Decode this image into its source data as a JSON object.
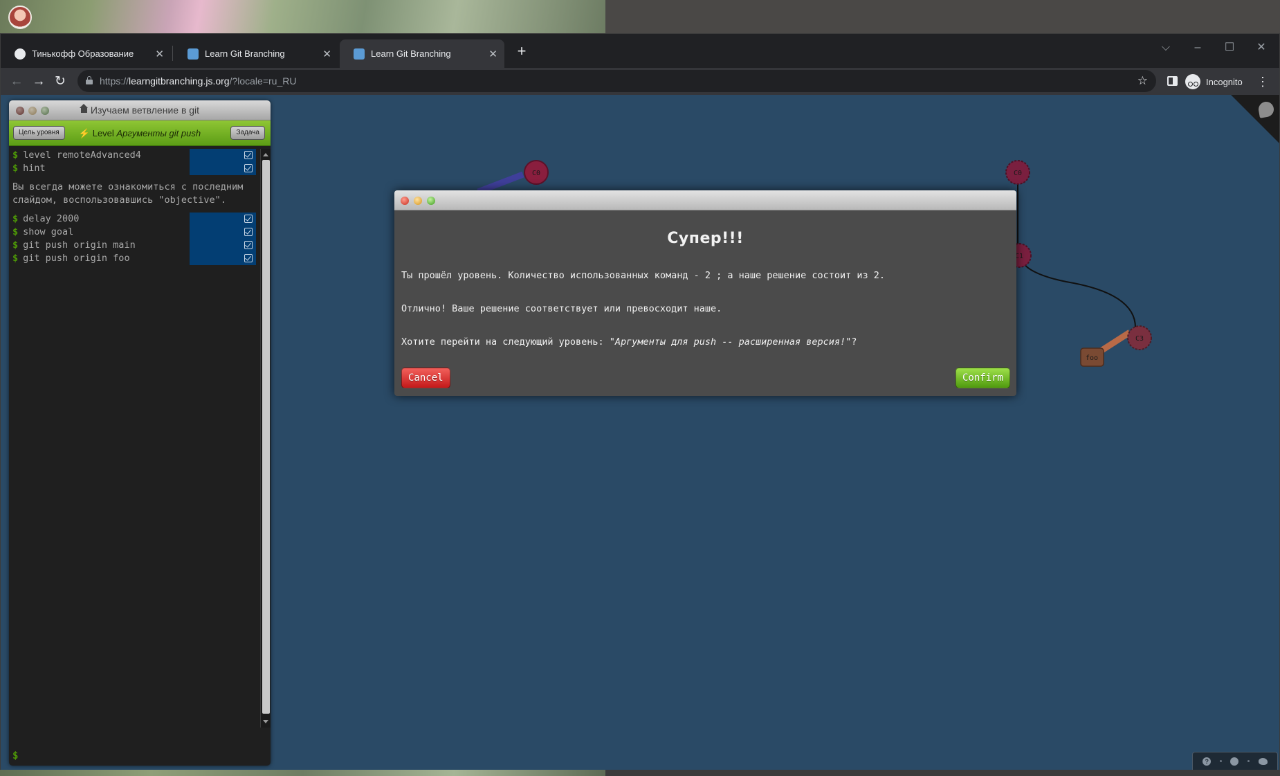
{
  "browser": {
    "tabs": [
      {
        "title": "Тинькофф Образование",
        "favicon_color": "#e8eaed",
        "active": false
      },
      {
        "title": "Learn Git Branching",
        "favicon_color": "#5b9bd5",
        "active": false
      },
      {
        "title": "Learn Git Branching",
        "favicon_color": "#5b9bd5",
        "active": true
      }
    ],
    "new_tab_symbol": "+",
    "window_controls": {
      "dropdown": "⌵",
      "minimize": "–",
      "maximize": "☐",
      "close": "✕"
    },
    "nav": {
      "back": "←",
      "forward": "→",
      "reload": "↻"
    },
    "url_scheme": "https://",
    "url_host": "learngitbranching.js.org",
    "url_path": "/?locale=ru_RU",
    "star_icon": "☆",
    "incognito_label": "Incognito",
    "menu_icon": "⋮"
  },
  "terminal": {
    "title": "Изучаем ветвление в git",
    "goal_button": "Цель уровня",
    "level_prefix": "Level",
    "level_name": "Аргументы git push",
    "objective_button": "Задача",
    "commands": [
      {
        "text": "level remoteAdvanced4",
        "done": true
      },
      {
        "text": "hint",
        "done": true
      }
    ],
    "hint": "Вы всегда можете ознакомиться с последним слайдом, воспользовавшись \"objective\".",
    "commands2": [
      {
        "text": "delay 2000",
        "done": true
      },
      {
        "text": "show goal",
        "done": true
      },
      {
        "text": "git push origin main",
        "done": true
      },
      {
        "text": "git push origin foo",
        "done": true
      }
    ],
    "prompt_symbol": "$"
  },
  "graph": {
    "nodes": [
      {
        "id": "C0",
        "color": "#8a1e3e"
      },
      {
        "id": "C0",
        "color": "#7a1f3f"
      },
      {
        "id": "C1",
        "color": "#7a1f3f"
      },
      {
        "id": "C3",
        "color": "#7a2f3f"
      }
    ],
    "branches": [
      {
        "name": "foo",
        "color": "#7a4a33"
      }
    ]
  },
  "modal": {
    "heading": "Супер!!!",
    "line1": "Ты прошёл уровень. Количество использованных команд - 2 ; а наше решение состоит из 2.",
    "line2": "Отлично! Ваше решение соответствует или превосходит наше.",
    "line3_prefix": "Хотите перейти на следующий уровень: ",
    "line3_level": "\"Аргументы для push -- расширенная версия!\"",
    "line3_suffix": "?",
    "cancel_label": "Cancel",
    "confirm_label": "Confirm"
  },
  "footer": {
    "help_icon": "?",
    "globe_icon": "globe",
    "twitter_icon": "twitter"
  },
  "colors": {
    "page_bg": "#2a4a66",
    "terminal_bg": "#1f1f1f",
    "level_bar": "#7ab526",
    "status_bg": "#033e73",
    "modal_bg": "#4b4b4b",
    "cancel": "#d52a26",
    "confirm": "#6dbb1c"
  }
}
